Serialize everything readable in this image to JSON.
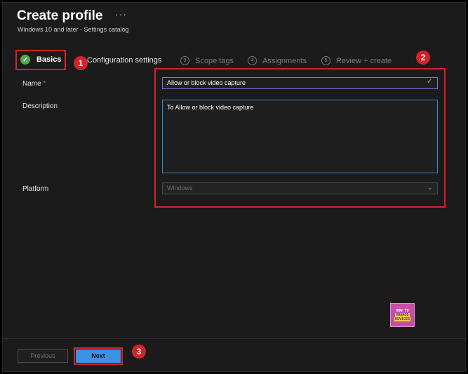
{
  "header": {
    "title": "Create profile",
    "more": "···",
    "subtitle": "Windows 10 and later - Settings catalog"
  },
  "tabs": [
    {
      "label": "Basics",
      "state": "complete"
    },
    {
      "label": "Configuration settings",
      "state": "upcoming"
    },
    {
      "number": "3",
      "label": "Scope tags"
    },
    {
      "number": "4",
      "label": "Assignments"
    },
    {
      "number": "5",
      "label": "Review + create"
    }
  ],
  "form": {
    "name_label": "Name",
    "required_mark": "*",
    "name_value": "Allow or block video capture",
    "description_label": "Description",
    "description_value": "To Allow or block video capture",
    "platform_label": "Platform",
    "platform_value": "Windows"
  },
  "footer": {
    "previous_label": "Previous",
    "next_label": "Next"
  },
  "annotations": [
    "1",
    "2",
    "3"
  ],
  "logo": {
    "line1": "HOW TO",
    "line2": "MANAGE",
    "line3": "DEVICES"
  },
  "colors": {
    "highlight": "#d2232a",
    "accent_blue": "#3a93e6",
    "success": "#57a64a"
  }
}
